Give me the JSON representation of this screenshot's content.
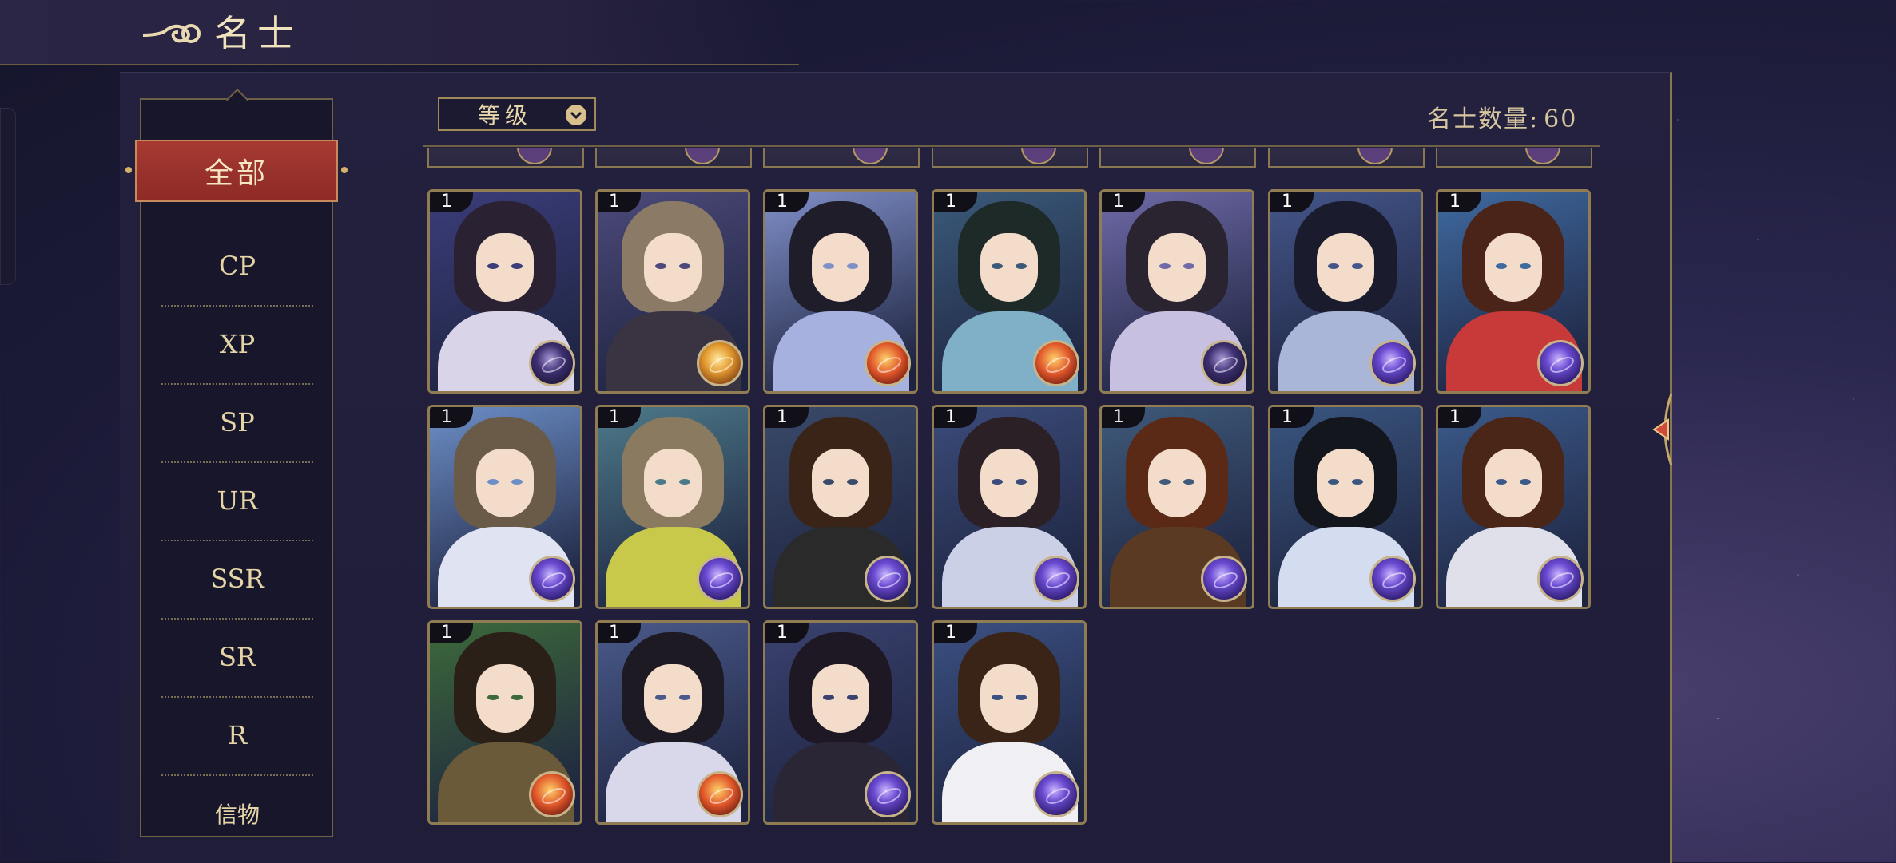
{
  "header": {
    "title": "名士",
    "icon": "cloud-swirl-icon"
  },
  "sidebar": {
    "items": [
      {
        "label": "全部",
        "active": true
      },
      {
        "label": "CP"
      },
      {
        "label": "XP"
      },
      {
        "label": "SP"
      },
      {
        "label": "UR"
      },
      {
        "label": "SSR"
      },
      {
        "label": "SR"
      },
      {
        "label": "R"
      },
      {
        "label": "信物"
      }
    ]
  },
  "sort": {
    "label": "等级",
    "icon": "chevron-down-icon"
  },
  "count": {
    "label": "名士数量:",
    "value": "60"
  },
  "colors": {
    "accent_red": "#9a322c",
    "gold_border": "#8f7c52",
    "panel": "#201e3a"
  },
  "cards": [
    {
      "level": "1",
      "orb": "dark"
    },
    {
      "level": "1",
      "orb": "gold"
    },
    {
      "level": "1",
      "orb": "flame"
    },
    {
      "level": "1",
      "orb": "flame"
    },
    {
      "level": "1",
      "orb": "dark"
    },
    {
      "level": "1",
      "orb": "purple"
    },
    {
      "level": "1",
      "orb": "purple"
    },
    {
      "level": "1",
      "orb": "purple"
    },
    {
      "level": "1",
      "orb": "purple"
    },
    {
      "level": "1",
      "orb": "purple"
    },
    {
      "level": "1",
      "orb": "purple"
    },
    {
      "level": "1",
      "orb": "purple"
    },
    {
      "level": "1",
      "orb": "purple"
    },
    {
      "level": "1",
      "orb": "purple"
    },
    {
      "level": "1",
      "orb": "flame"
    },
    {
      "level": "1",
      "orb": "flame"
    },
    {
      "level": "1",
      "orb": "purple"
    },
    {
      "level": "1",
      "orb": "purple"
    }
  ]
}
